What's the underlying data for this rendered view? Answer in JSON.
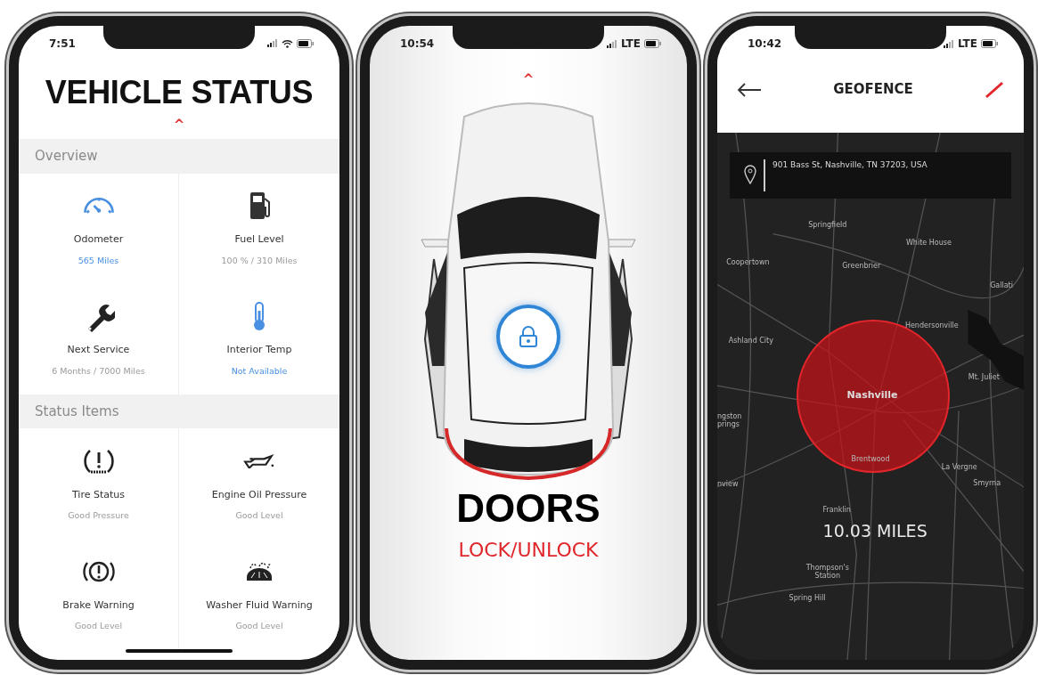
{
  "phones": [
    {
      "kind": "status",
      "status_bar": {
        "time": "7:51"
      },
      "title": "VEHICLE STATUS",
      "chevron": "^",
      "sections": [
        {
          "heading": "Overview",
          "items": [
            {
              "label": "Odometer",
              "value": "565 Miles",
              "highlighted": true
            },
            {
              "label": "Fuel Level",
              "value": "100 % / 310 Miles",
              "highlighted": false
            },
            {
              "label": "Next Service",
              "value": "6 Months / 7000 Miles",
              "highlighted": false
            },
            {
              "label": "Interior Temp",
              "value": "Not Available",
              "highlighted": true
            }
          ]
        },
        {
          "heading": "Status Items",
          "items": [
            {
              "label": "Tire Status",
              "value": "Good Pressure",
              "highlighted": false
            },
            {
              "label": "Engine Oil Pressure",
              "value": "Good Level",
              "highlighted": false
            },
            {
              "label": "Brake Warning",
              "value": "Good Level",
              "highlighted": false
            },
            {
              "label": "Washer Fluid Warning",
              "value": "Good Level",
              "highlighted": false
            }
          ]
        }
      ]
    },
    {
      "kind": "doors",
      "status_bar": {
        "time": "10:54",
        "network": "LTE"
      },
      "chevron": "^",
      "title": "DOORS",
      "subtitle": "LOCK/UNLOCK"
    },
    {
      "kind": "geofence",
      "status_bar": {
        "time": "10:42",
        "network": "LTE"
      },
      "title": "GEOFENCE",
      "address": "901 Bass St, Nashville, TN 37203, USA",
      "map_labels": [
        "Springfield",
        "White House",
        "Coopertown",
        "Greenbrier",
        "Gallati",
        "Hendersonville",
        "Ashland City",
        "Mt. Juliet",
        "Nashville",
        "ngston prings",
        "Brentwood",
        "La Vergne",
        "Smyrna",
        "nview",
        "Franklin",
        "Thompson's Station",
        "Spring Hill"
      ],
      "distance": "10.03 MILES"
    }
  ]
}
